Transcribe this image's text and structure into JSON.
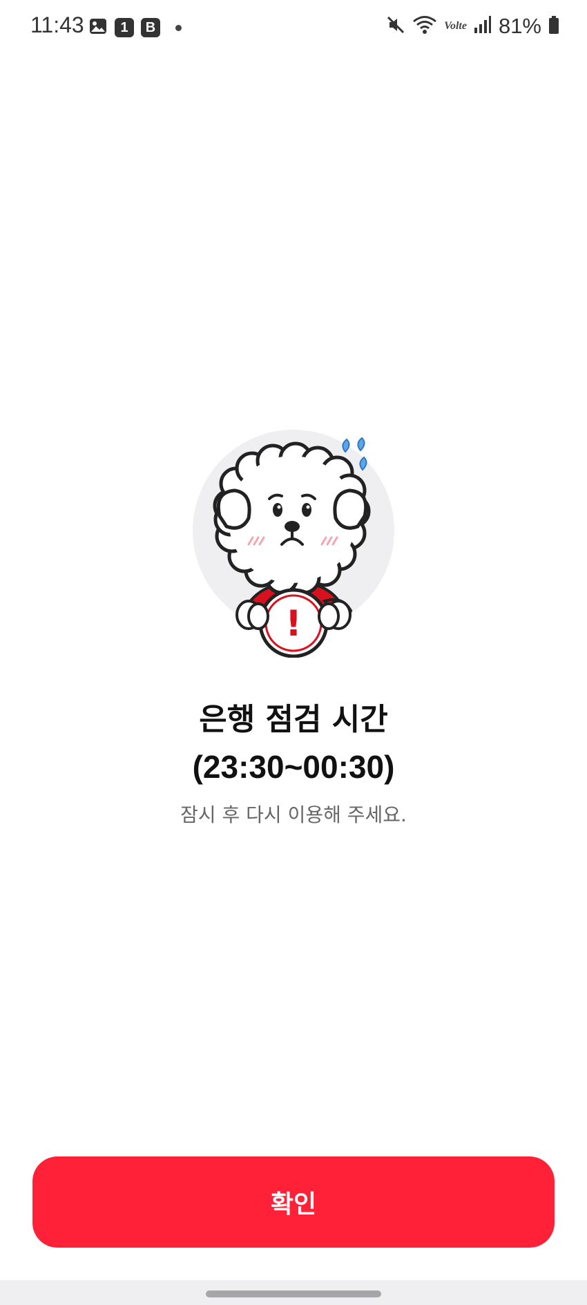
{
  "status_bar": {
    "time": "11:43",
    "notif_badge_1": "1",
    "notif_badge_b": "B",
    "lte_label": "Volte",
    "battery": "81%"
  },
  "illustration": {
    "sign_symbol": "!"
  },
  "notice": {
    "title": "은행 점검 시간",
    "hours": "(23:30~00:30)",
    "message": "잠시 후 다시 이용해 주세요."
  },
  "actions": {
    "confirm_label": "확인"
  },
  "colors": {
    "accent": "#ff2138",
    "background": "#ffffff",
    "circle_bg": "#efeff1"
  },
  "icons": [
    "image-icon",
    "app-1-icon",
    "app-b-icon",
    "mute-icon",
    "wifi-icon",
    "signal-icon",
    "battery-icon"
  ]
}
